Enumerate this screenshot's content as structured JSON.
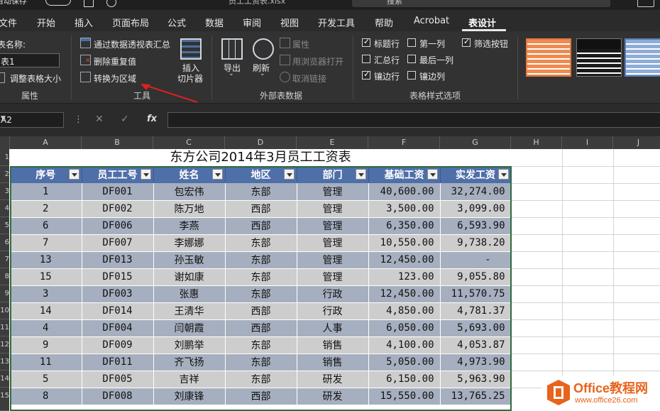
{
  "titlebar": {
    "autosave_label": "自动保存",
    "toggle_state": "关",
    "filename": "员工工资表.xlsx",
    "search_placeholder": "搜索"
  },
  "tabs": [
    "文件",
    "开始",
    "插入",
    "页面布局",
    "公式",
    "数据",
    "审阅",
    "视图",
    "开发工具",
    "帮助",
    "Acrobat",
    "表设计"
  ],
  "active_tab": "表设计",
  "ribbon": {
    "properties": {
      "name_label": "表名称:",
      "name_value": "表1",
      "resize_label": "调整表格大小",
      "group_label": "属性"
    },
    "tools": {
      "pivot_label": "通过数据透视表汇总",
      "remove_dup_label": "删除重复值",
      "convert_label": "转换为区域",
      "slicer_label": "插入\n切片器",
      "slicer_line1": "插入",
      "slicer_line2": "切片器",
      "group_label": "工具"
    },
    "external": {
      "export_label": "导出",
      "refresh_label": "刷新",
      "properties_label": "属性",
      "open_browser_label": "用浏览器打开",
      "unlink_label": "取消链接",
      "group_label": "外部表数据"
    },
    "style_options": {
      "header_row": {
        "label": "标题行",
        "checked": true
      },
      "total_row": {
        "label": "汇总行",
        "checked": false
      },
      "banded_rows": {
        "label": "镶边行",
        "checked": true
      },
      "first_column": {
        "label": "第一列",
        "checked": false
      },
      "last_column": {
        "label": "最后一列",
        "checked": false
      },
      "banded_columns": {
        "label": "镶边列",
        "checked": false
      },
      "filter_button": {
        "label": "筛选按钮",
        "checked": true
      },
      "group_label": "表格样式选项"
    }
  },
  "formula_bar": {
    "name_box": "A2",
    "formula": ""
  },
  "sheet": {
    "columns": [
      "A",
      "B",
      "C",
      "D",
      "E",
      "F",
      "G",
      "H",
      "I",
      "J"
    ],
    "row_numbers": [
      "1",
      "2",
      "3",
      "4",
      "5",
      "6",
      "7",
      "8",
      "9",
      "10",
      "11",
      "12",
      "13",
      "14",
      "15"
    ],
    "title": "东方公司2014年3月员工工资表",
    "headers": [
      "序号",
      "员工工号",
      "姓名",
      "地区",
      "部门",
      "基础工资",
      "实发工资"
    ],
    "rows": [
      [
        "1",
        "DF001",
        "包宏伟",
        "东部",
        "管理",
        "40,600.00",
        "32,274.00"
      ],
      [
        "2",
        "DF002",
        "陈万地",
        "西部",
        "管理",
        "3,500.00",
        "3,099.00"
      ],
      [
        "6",
        "DF006",
        "李燕",
        "西部",
        "管理",
        "6,350.00",
        "6,593.90"
      ],
      [
        "7",
        "DF007",
        "李娜娜",
        "东部",
        "管理",
        "10,550.00",
        "9,738.20"
      ],
      [
        "13",
        "DF013",
        "孙玉敏",
        "东部",
        "管理",
        "12,450.00",
        "-"
      ],
      [
        "15",
        "DF015",
        "谢如康",
        "东部",
        "管理",
        "123.00",
        "9,055.80"
      ],
      [
        "3",
        "DF003",
        "张惠",
        "东部",
        "行政",
        "12,450.00",
        "11,570.75"
      ],
      [
        "14",
        "DF014",
        "王清华",
        "西部",
        "行政",
        "4,850.00",
        "4,781.37"
      ],
      [
        "4",
        "DF004",
        "闫朝霞",
        "西部",
        "人事",
        "6,050.00",
        "5,693.00"
      ],
      [
        "9",
        "DF009",
        "刘鹏举",
        "东部",
        "销售",
        "4,100.00",
        "4,053.87"
      ],
      [
        "11",
        "DF011",
        "齐飞扬",
        "东部",
        "销售",
        "5,050.00",
        "4,973.90"
      ],
      [
        "5",
        "DF005",
        "吉祥",
        "东部",
        "研发",
        "6,150.00",
        "5,963.90"
      ],
      [
        "8",
        "DF008",
        "刘康锋",
        "西部",
        "研发",
        "15,550.00",
        "13,765.25"
      ]
    ]
  },
  "watermark": {
    "title": "Office教程网",
    "url": "www.office26.com"
  },
  "colors": {
    "table_header": "#4e6fa8",
    "band_odd": "#a6afbf",
    "band_even": "#cdcdcd",
    "arrow": "#e02020",
    "watermark": "#e8631c"
  }
}
